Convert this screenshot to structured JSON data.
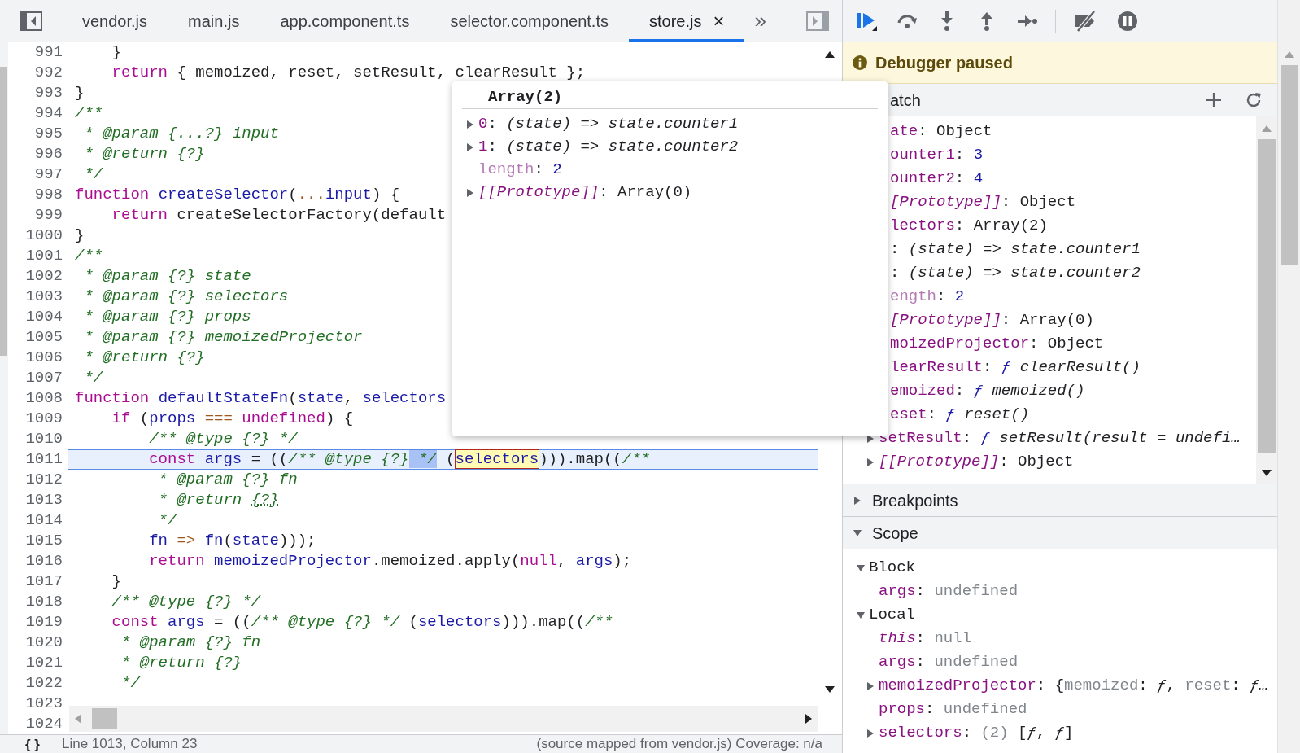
{
  "tabs": [
    {
      "label": "vendor.js",
      "selected": false
    },
    {
      "label": "main.js",
      "selected": false
    },
    {
      "label": "app.component.ts",
      "selected": false
    },
    {
      "label": "selector.component.ts",
      "selected": false
    },
    {
      "label": "store.js",
      "selected": true,
      "close": "×"
    }
  ],
  "tabs_overflow": "»",
  "code": {
    "lines": [
      {
        "number": "991",
        "current": false,
        "tokens": [
          {
            "text": "    }",
            "kind": "plain"
          }
        ]
      },
      {
        "number": "992",
        "current": false,
        "tokens": [
          {
            "text": "    return",
            "kind": "keyword"
          },
          {
            "text": " { memoized, reset, setResult, clearResult };",
            "kind": "plain"
          }
        ]
      },
      {
        "number": "993",
        "current": false,
        "tokens": [
          {
            "text": "}",
            "kind": "plain"
          }
        ]
      },
      {
        "number": "994",
        "current": false,
        "tokens": [
          {
            "text": "/**",
            "kind": "comment"
          }
        ]
      },
      {
        "number": "995",
        "current": false,
        "tokens": [
          {
            "text": " * @param {...?} input",
            "kind": "comment"
          }
        ]
      },
      {
        "number": "996",
        "current": false,
        "tokens": [
          {
            "text": " * @return {?}",
            "kind": "comment"
          }
        ]
      },
      {
        "number": "997",
        "current": false,
        "tokens": [
          {
            "text": " */",
            "kind": "comment"
          }
        ]
      },
      {
        "number": "998",
        "current": false,
        "tokens": [
          {
            "text": "function ",
            "kind": "keyword"
          },
          {
            "text": "createSelector",
            "kind": "name"
          },
          {
            "text": "(",
            "kind": "plain"
          },
          {
            "text": "...",
            "kind": "operator"
          },
          {
            "text": "input",
            "kind": "name"
          },
          {
            "text": ") {",
            "kind": "plain"
          }
        ]
      },
      {
        "number": "999",
        "current": false,
        "tokens": [
          {
            "text": "    return",
            "kind": "keyword"
          },
          {
            "text": " createSelectorFactory(default",
            "kind": "plain"
          }
        ]
      },
      {
        "number": "1000",
        "current": false,
        "tokens": [
          {
            "text": "}",
            "kind": "plain"
          }
        ]
      },
      {
        "number": "1001",
        "current": false,
        "tokens": [
          {
            "text": "/**",
            "kind": "comment"
          }
        ]
      },
      {
        "number": "1002",
        "current": false,
        "tokens": [
          {
            "text": " * @param {?} state",
            "kind": "comment"
          }
        ]
      },
      {
        "number": "1003",
        "current": false,
        "tokens": [
          {
            "text": " * @param {?} selectors",
            "kind": "comment"
          }
        ]
      },
      {
        "number": "1004",
        "current": false,
        "tokens": [
          {
            "text": " * @param {?} props",
            "kind": "comment"
          }
        ]
      },
      {
        "number": "1005",
        "current": false,
        "tokens": [
          {
            "text": " * @param {?} memoizedProjector",
            "kind": "comment"
          }
        ]
      },
      {
        "number": "1006",
        "current": false,
        "tokens": [
          {
            "text": " * @return {?}",
            "kind": "comment"
          }
        ]
      },
      {
        "number": "1007",
        "current": false,
        "tokens": [
          {
            "text": " */",
            "kind": "comment"
          }
        ]
      },
      {
        "number": "1008",
        "current": false,
        "tokens": [
          {
            "text": "function ",
            "kind": "keyword"
          },
          {
            "text": "defaultStateFn",
            "kind": "name"
          },
          {
            "text": "(",
            "kind": "plain"
          },
          {
            "text": "state",
            "kind": "name"
          },
          {
            "text": ", ",
            "kind": "plain"
          },
          {
            "text": "selectors",
            "kind": "name"
          }
        ]
      },
      {
        "number": "1009",
        "current": false,
        "tokens": [
          {
            "text": "    if",
            "kind": "keyword"
          },
          {
            "text": " (",
            "kind": "plain"
          },
          {
            "text": "props",
            "kind": "name"
          },
          {
            "text": " === ",
            "kind": "operator"
          },
          {
            "text": "undefined",
            "kind": "keyword"
          },
          {
            "text": ") {",
            "kind": "plain"
          }
        ]
      },
      {
        "number": "1010",
        "current": false,
        "tokens": [
          {
            "text": "        /** @type {?} */",
            "kind": "comment"
          }
        ]
      },
      {
        "number": "1011",
        "current": true,
        "tokens": [
          {
            "text": "        const ",
            "kind": "keyword"
          },
          {
            "text": "args",
            "kind": "name"
          },
          {
            "text": " = ((",
            "kind": "plain"
          },
          {
            "text": "/** @type {?}",
            "kind": "comment"
          },
          {
            "text": " */",
            "kind": "selection"
          },
          {
            "text": " (",
            "kind": "plain"
          },
          {
            "text": "selectors",
            "kind": "hovered"
          },
          {
            "text": "))).map((",
            "kind": "plain"
          },
          {
            "text": "/**",
            "kind": "comment"
          }
        ]
      },
      {
        "number": "1012",
        "current": false,
        "tokens": [
          {
            "text": "         * @param {?} fn",
            "kind": "comment"
          }
        ]
      },
      {
        "number": "1013",
        "current": false,
        "tokens": [
          {
            "text": "         * @return ",
            "kind": "comment"
          },
          {
            "text": "{?}",
            "kind": "dotted"
          }
        ]
      },
      {
        "number": "1014",
        "current": false,
        "tokens": [
          {
            "text": "         */",
            "kind": "comment"
          }
        ]
      },
      {
        "number": "1015",
        "current": false,
        "tokens": [
          {
            "text": "        fn",
            "kind": "name"
          },
          {
            "text": " => ",
            "kind": "operator"
          },
          {
            "text": "fn",
            "kind": "name"
          },
          {
            "text": "(",
            "kind": "plain"
          },
          {
            "text": "state",
            "kind": "name"
          },
          {
            "text": ")));",
            "kind": "plain"
          }
        ]
      },
      {
        "number": "1016",
        "current": false,
        "tokens": [
          {
            "text": "        return ",
            "kind": "keyword"
          },
          {
            "text": "memoizedProjector",
            "kind": "name"
          },
          {
            "text": ".memoized.apply(",
            "kind": "plain"
          },
          {
            "text": "null",
            "kind": "keyword"
          },
          {
            "text": ", ",
            "kind": "plain"
          },
          {
            "text": "args",
            "kind": "name"
          },
          {
            "text": ");",
            "kind": "plain"
          }
        ]
      },
      {
        "number": "1017",
        "current": false,
        "tokens": [
          {
            "text": "    }",
            "kind": "plain"
          }
        ]
      },
      {
        "number": "1018",
        "current": false,
        "tokens": [
          {
            "text": "    /** @type {?} */",
            "kind": "comment"
          }
        ]
      },
      {
        "number": "1019",
        "current": false,
        "tokens": [
          {
            "text": "    const ",
            "kind": "keyword"
          },
          {
            "text": "args",
            "kind": "name"
          },
          {
            "text": " = ((",
            "kind": "plain"
          },
          {
            "text": "/** @type {?} */",
            "kind": "comment"
          },
          {
            "text": " (",
            "kind": "plain"
          },
          {
            "text": "selectors",
            "kind": "name"
          },
          {
            "text": "))).map((",
            "kind": "plain"
          },
          {
            "text": "/**",
            "kind": "comment"
          }
        ]
      },
      {
        "number": "1020",
        "current": false,
        "tokens": [
          {
            "text": "     * @param {?} fn",
            "kind": "comment"
          }
        ]
      },
      {
        "number": "1021",
        "current": false,
        "tokens": [
          {
            "text": "     * @return {?}",
            "kind": "comment"
          }
        ]
      },
      {
        "number": "1022",
        "current": false,
        "tokens": [
          {
            "text": "     */",
            "kind": "comment"
          }
        ]
      },
      {
        "number": "1023",
        "current": false
      },
      {
        "number": "1024",
        "current": false
      }
    ],
    "status": {
      "format_button": "{ }",
      "cursor": "Line 1013, Column 23",
      "source": "(source mapped from vendor.js) Coverage: n/a"
    }
  },
  "popover": {
    "title": "Array(2)",
    "rows": [
      {
        "expanded": false,
        "tokens": [
          {
            "text": "0",
            "kind": "property"
          },
          {
            "text": ": ",
            "kind": "plain"
          },
          {
            "text": "(state) => state.counter1",
            "kind": "italic"
          }
        ]
      },
      {
        "expanded": false,
        "tokens": [
          {
            "text": "1",
            "kind": "property"
          },
          {
            "text": ": ",
            "kind": "plain"
          },
          {
            "text": "(state) => state.counter2",
            "kind": "italic"
          }
        ]
      },
      {
        "tokens": [
          {
            "text": "length",
            "kind": "faded"
          },
          {
            "text": ": ",
            "kind": "plain"
          },
          {
            "text": "2",
            "kind": "number"
          }
        ]
      },
      {
        "expanded": false,
        "tokens": [
          {
            "text": "[[Prototype]]",
            "kind": "internal"
          },
          {
            "text": ": Array(0)",
            "kind": "plain"
          }
        ]
      }
    ]
  },
  "debugger": {
    "banner": "Debugger paused",
    "watch": {
      "header": "atch",
      "rows": [
        {
          "tokens": [
            {
              "text": "ate",
              "kind": "property"
            },
            {
              "text": ": Object",
              "kind": "plain"
            }
          ]
        },
        {
          "tokens": [
            {
              "text": "ounter1",
              "kind": "property"
            },
            {
              "text": ": ",
              "kind": "plain"
            },
            {
              "text": "3",
              "kind": "number"
            }
          ]
        },
        {
          "tokens": [
            {
              "text": "ounter2",
              "kind": "property"
            },
            {
              "text": ": ",
              "kind": "plain"
            },
            {
              "text": "4",
              "kind": "number"
            }
          ]
        },
        {
          "tokens": [
            {
              "text": "[Prototype]]",
              "kind": "internal"
            },
            {
              "text": ": Object",
              "kind": "plain"
            }
          ]
        },
        {
          "tokens": [
            {
              "text": "lectors",
              "kind": "property"
            },
            {
              "text": ": Array(2)",
              "kind": "plain"
            }
          ]
        },
        {
          "tokens": [
            {
              "text": ": ",
              "kind": "plain"
            },
            {
              "text": "(state) => state.counter1",
              "kind": "italic"
            }
          ]
        },
        {
          "tokens": [
            {
              "text": ": ",
              "kind": "plain"
            },
            {
              "text": "(state) => state.counter2",
              "kind": "italic"
            }
          ]
        },
        {
          "tokens": [
            {
              "text": "ength",
              "kind": "faded"
            },
            {
              "text": ": ",
              "kind": "plain"
            },
            {
              "text": "2",
              "kind": "number"
            }
          ]
        },
        {
          "tokens": [
            {
              "text": "[Prototype]]",
              "kind": "internal"
            },
            {
              "text": ": Array(0)",
              "kind": "plain"
            }
          ]
        },
        {
          "tokens": [
            {
              "text": "moizedProjector",
              "kind": "property"
            },
            {
              "text": ": Object",
              "kind": "plain"
            }
          ]
        },
        {
          "tokens": [
            {
              "text": "learResult",
              "kind": "property"
            },
            {
              "text": ": ",
              "kind": "plain"
            },
            {
              "text": "ƒ",
              "kind": "function"
            },
            {
              "text": " clearResult()",
              "kind": "italic"
            }
          ]
        },
        {
          "tokens": [
            {
              "text": "emoized",
              "kind": "property"
            },
            {
              "text": ": ",
              "kind": "plain"
            },
            {
              "text": "ƒ",
              "kind": "function"
            },
            {
              "text": " memoized()",
              "kind": "italic"
            }
          ]
        },
        {
          "tokens": [
            {
              "text": "eset",
              "kind": "property"
            },
            {
              "text": ": ",
              "kind": "plain"
            },
            {
              "text": "ƒ",
              "kind": "function"
            },
            {
              "text": " reset()",
              "kind": "italic"
            }
          ]
        },
        {
          "expanded": false,
          "tokens": [
            {
              "text": "setResult",
              "kind": "property"
            },
            {
              "text": ": ",
              "kind": "plain"
            },
            {
              "text": "ƒ",
              "kind": "function"
            },
            {
              "text": " setResult(result = undefi…",
              "kind": "italic"
            }
          ]
        },
        {
          "expanded": false,
          "tokens": [
            {
              "text": "[[Prototype]]",
              "kind": "internal"
            },
            {
              "text": ": Object",
              "kind": "plain"
            }
          ]
        }
      ]
    },
    "breakpoints": {
      "header": "Breakpoints",
      "expanded": false
    },
    "scope": {
      "header": "Scope",
      "expanded": true,
      "rows": [
        {
          "expanded": true,
          "tokens": [
            {
              "text": "Block",
              "kind": "plain"
            }
          ],
          "children": [
            {
              "tokens": [
                {
                  "text": "args",
                  "kind": "property"
                },
                {
                  "text": ": ",
                  "kind": "plain"
                },
                {
                  "text": "undefined",
                  "kind": "muted"
                }
              ]
            }
          ]
        },
        {
          "expanded": true,
          "tokens": [
            {
              "text": "Local",
              "kind": "plain"
            }
          ],
          "children": [
            {
              "tokens": [
                {
                  "text": "this",
                  "kind": "internal"
                },
                {
                  "text": ": ",
                  "kind": "plain"
                },
                {
                  "text": "null",
                  "kind": "muted"
                }
              ]
            },
            {
              "tokens": [
                {
                  "text": "args",
                  "kind": "property"
                },
                {
                  "text": ": ",
                  "kind": "plain"
                },
                {
                  "text": "undefined",
                  "kind": "muted"
                }
              ]
            },
            {
              "expanded": false,
              "tokens": [
                {
                  "text": "memoizedProjector",
                  "kind": "property"
                },
                {
                  "text": ": {",
                  "kind": "plain"
                },
                {
                  "text": "memoized",
                  "kind": "muted"
                },
                {
                  "text": ": ",
                  "kind": "plain"
                },
                {
                  "text": "ƒ",
                  "kind": "italic"
                },
                {
                  "text": ", ",
                  "kind": "plain"
                },
                {
                  "text": "reset",
                  "kind": "muted"
                },
                {
                  "text": ": ",
                  "kind": "plain"
                },
                {
                  "text": "ƒ…",
                  "kind": "italic"
                }
              ]
            },
            {
              "tokens": [
                {
                  "text": "props",
                  "kind": "property"
                },
                {
                  "text": ": ",
                  "kind": "plain"
                },
                {
                  "text": "undefined",
                  "kind": "muted"
                }
              ]
            },
            {
              "expanded": false,
              "tokens": [
                {
                  "text": "selectors",
                  "kind": "property"
                },
                {
                  "text": ": ",
                  "kind": "plain"
                },
                {
                  "text": "(2) ",
                  "kind": "muted"
                },
                {
                  "text": "[",
                  "kind": "plain"
                },
                {
                  "text": "ƒ",
                  "kind": "italic"
                },
                {
                  "text": ", ",
                  "kind": "plain"
                },
                {
                  "text": "ƒ",
                  "kind": "italic"
                },
                {
                  "text": "]",
                  "kind": "plain"
                }
              ]
            }
          ]
        }
      ]
    }
  }
}
